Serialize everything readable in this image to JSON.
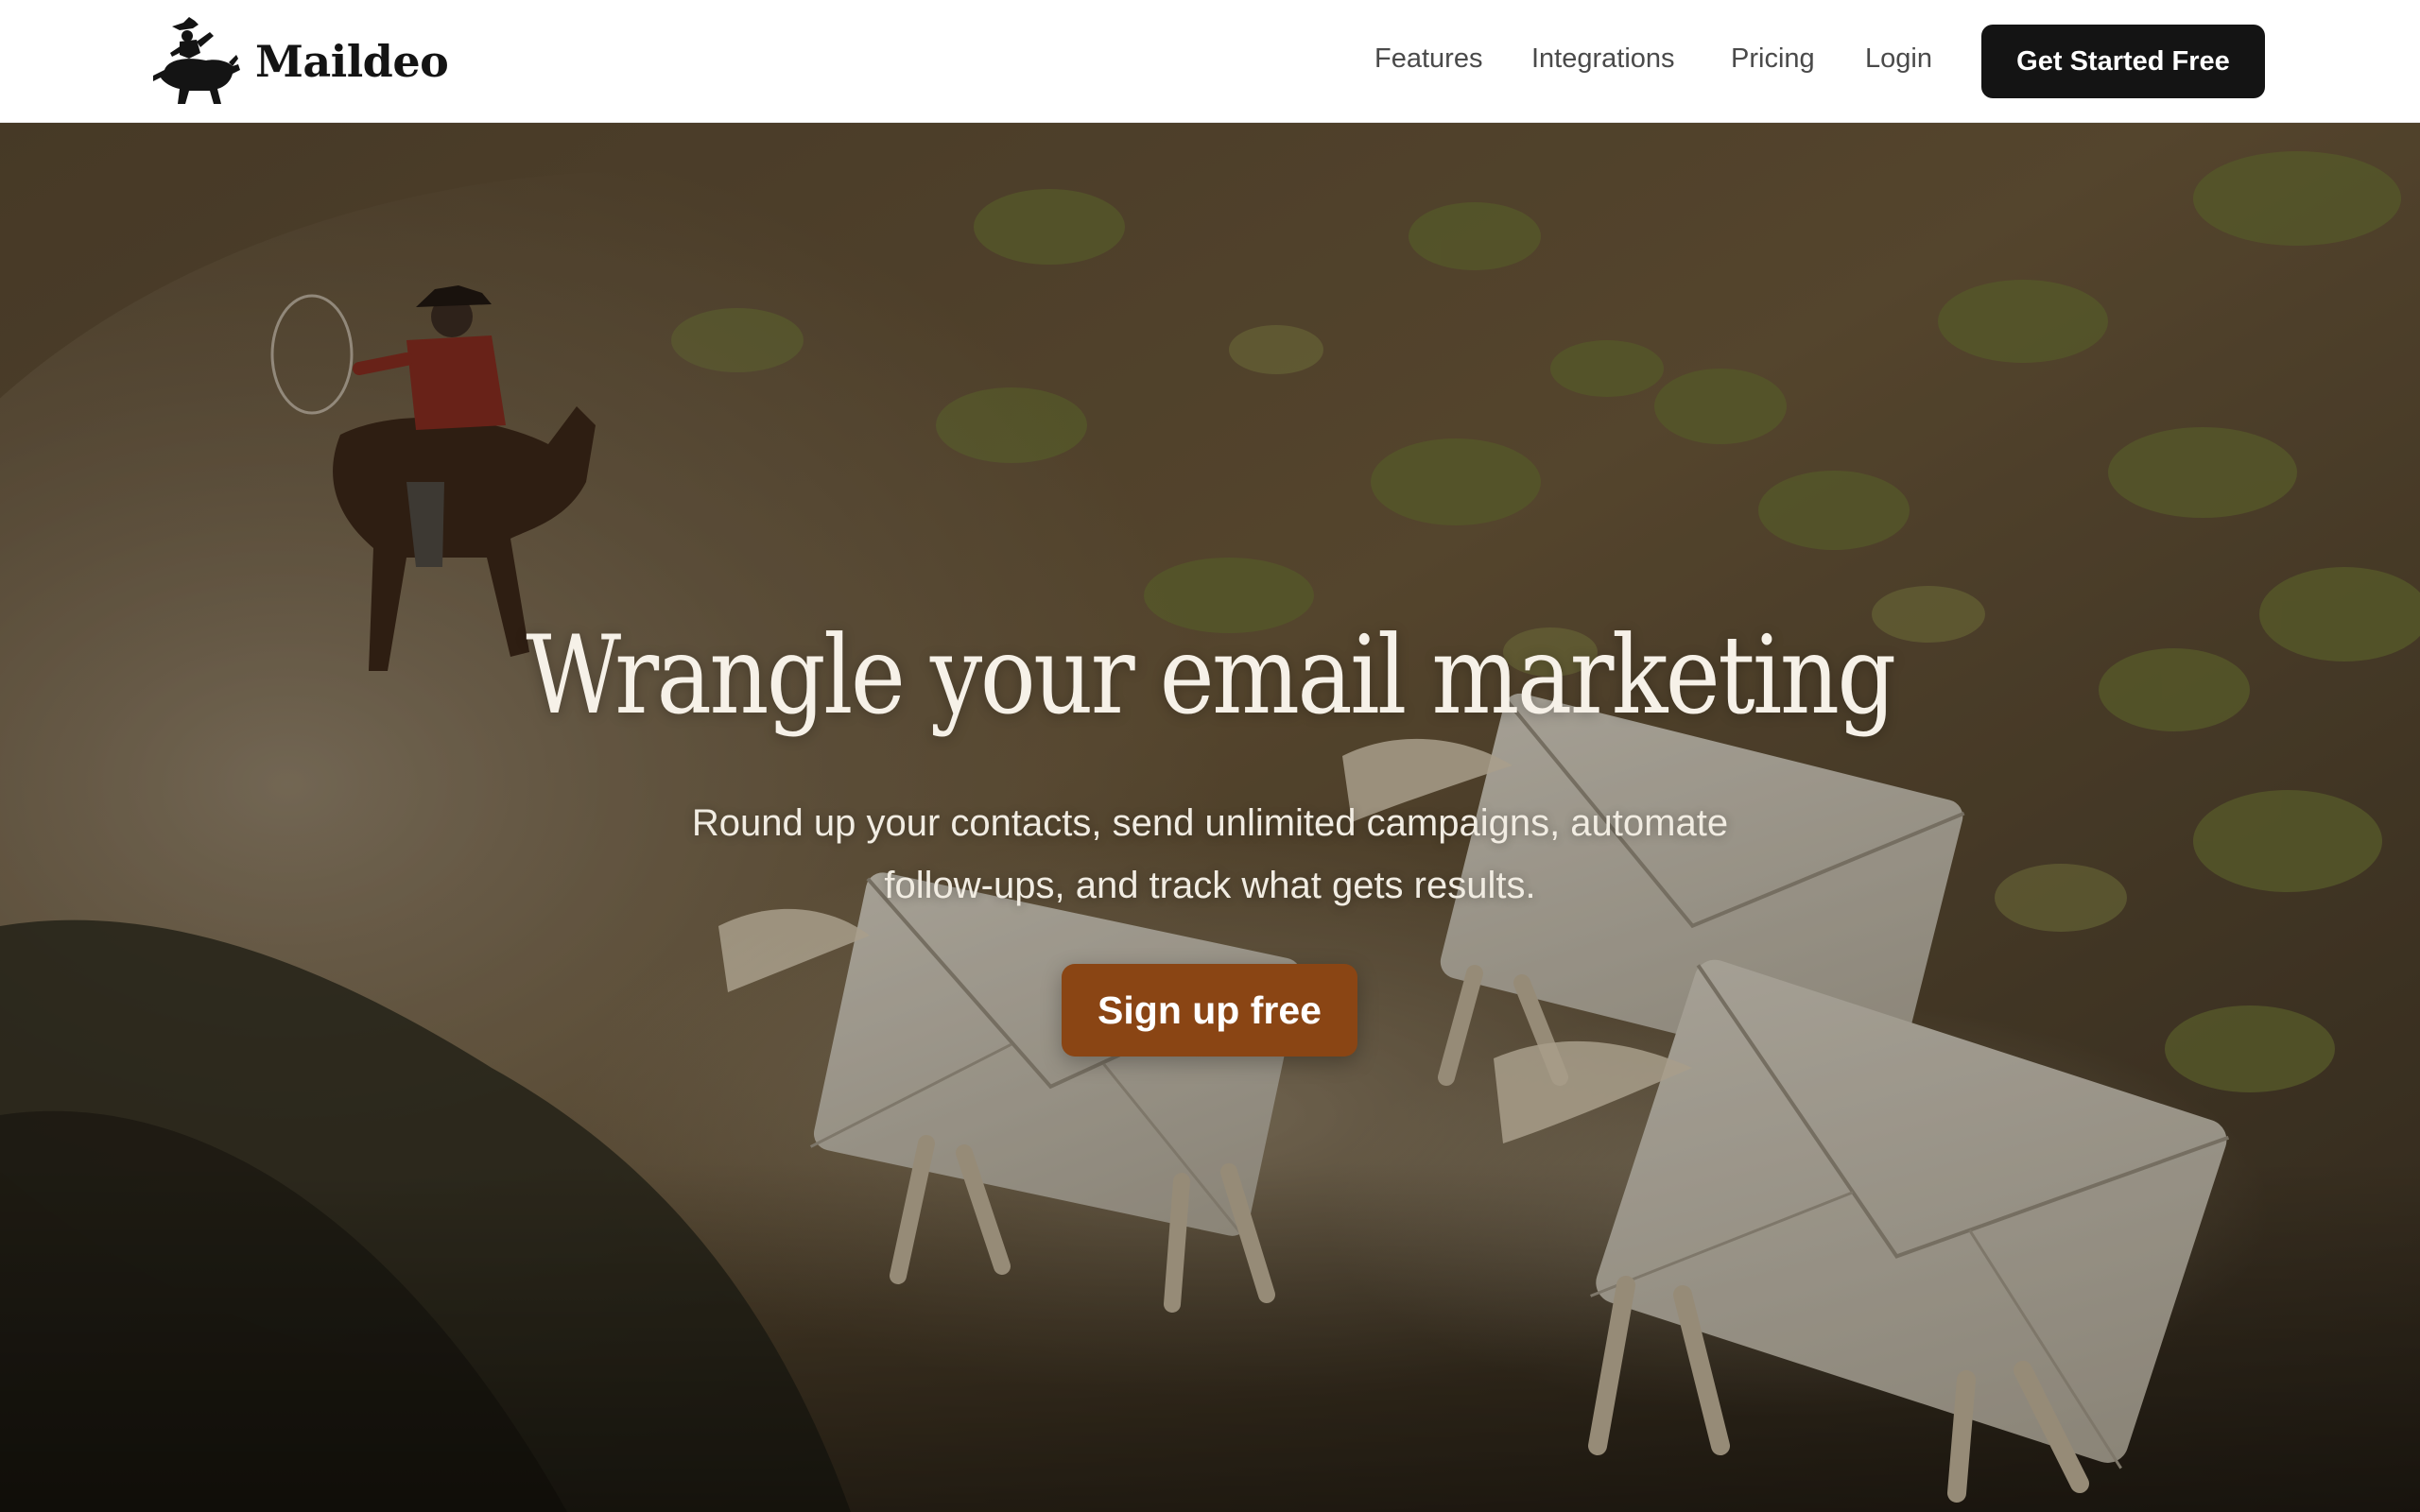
{
  "brand": {
    "name": "Maildeo",
    "logo_icon": "cowboy-riding-bull-icon"
  },
  "nav": {
    "links": [
      "Features",
      "Integrations",
      "Pricing",
      "Login"
    ],
    "cta_label": "Get Started Free"
  },
  "hero": {
    "title": "Wrangle your email marketing",
    "subtitle": "Round up your contacts, send unlimited campaigns, automate follow-ups, and track what gets results.",
    "cta_label": "Sign up free",
    "background_image": "cowboy-lassoing-envelope-horses-in-dusty-desert"
  },
  "colors": {
    "nav_bg": "#ffffff",
    "nav_text": "#4a4a4a",
    "dark_button": "#141414",
    "accent_button": "#8a4514",
    "hero_text": "#f6f1e8"
  }
}
